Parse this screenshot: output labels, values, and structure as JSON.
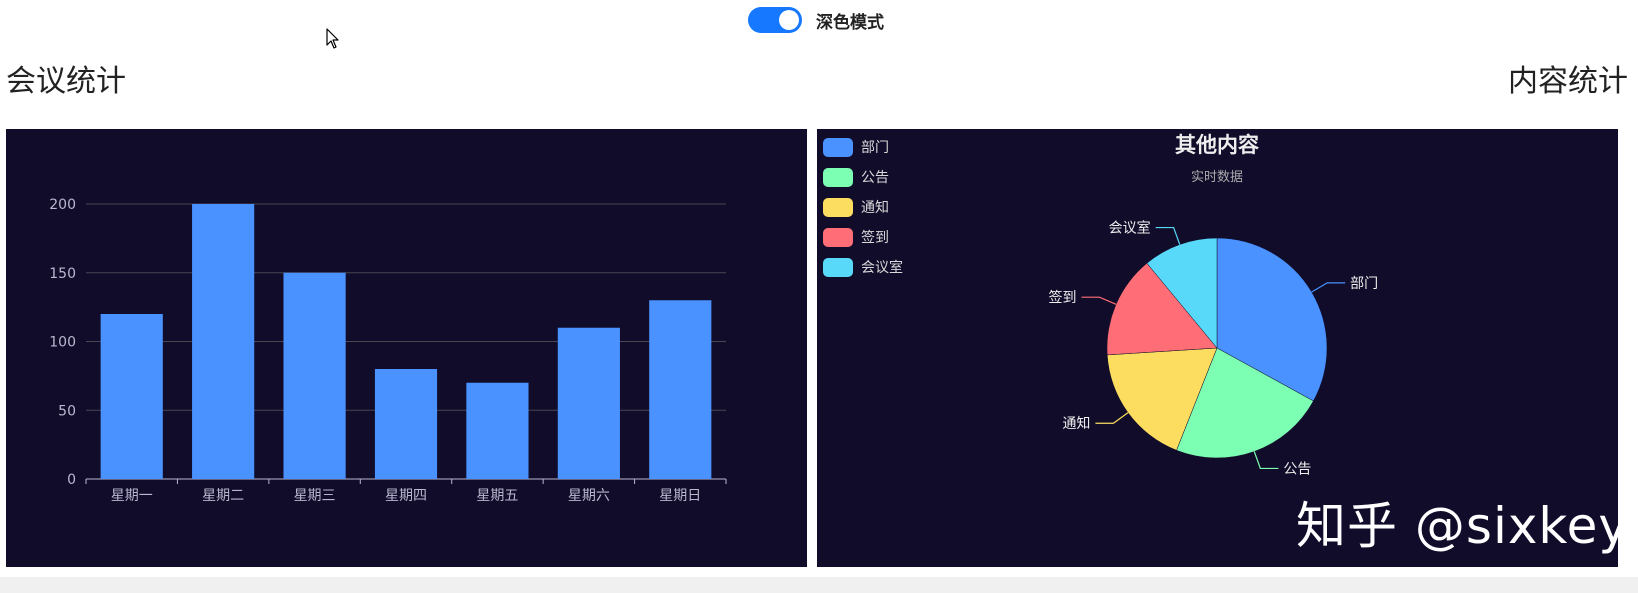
{
  "toolbar": {
    "dark_mode_label": "深色模式",
    "dark_mode_on": true,
    "accent": "#1677ff"
  },
  "left_section": {
    "title": "会议统计"
  },
  "right_section": {
    "title": "内容统计"
  },
  "watermark": "知乎 @sixkey",
  "chart_data": [
    {
      "type": "bar",
      "categories": [
        "星期一",
        "星期二",
        "星期三",
        "星期四",
        "星期五",
        "星期六",
        "星期日"
      ],
      "values": [
        120,
        200,
        150,
        80,
        70,
        110,
        130
      ],
      "ylim": [
        0,
        200
      ],
      "yticks": [
        0,
        50,
        100,
        150,
        200
      ],
      "grid": true,
      "bar_color": "#4992ff",
      "background": "#100c2a"
    },
    {
      "type": "pie",
      "title": "其他内容",
      "subtitle": "实时数据",
      "legend_position": "top-left",
      "slices": [
        {
          "name": "部门",
          "value": 33,
          "color": "#4992ff"
        },
        {
          "name": "公告",
          "value": 23,
          "color": "#7cffb2"
        },
        {
          "name": "通知",
          "value": 18,
          "color": "#fddd60"
        },
        {
          "name": "签到",
          "value": 15,
          "color": "#ff6e76"
        },
        {
          "name": "会议室",
          "value": 11,
          "color": "#58d9f9"
        }
      ],
      "background": "#100c2a"
    }
  ]
}
